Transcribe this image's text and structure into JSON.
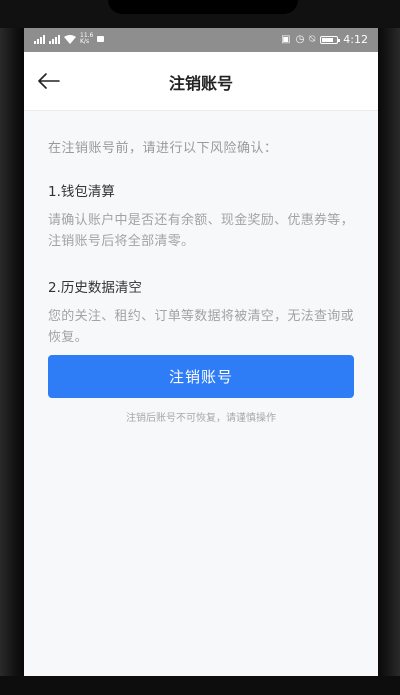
{
  "statusbar": {
    "net_speed_top": "11.6",
    "net_speed_bottom": "K/s",
    "time": "4:12"
  },
  "header": {
    "title": "注销账号",
    "back_icon": "arrow-left-icon"
  },
  "content": {
    "intro": "在注销账号前，请进行以下风险确认：",
    "sections": [
      {
        "title": "1.钱包清算",
        "body": "请确认账户中是否还有余额、现金奖励、优惠券等，注销账号后将全部清零。"
      },
      {
        "title": "2.历史数据清空",
        "body": "您的关注、租约、订单等数据将被清空，无法查询或恢复。"
      }
    ]
  },
  "action": {
    "button_label": "注销账号",
    "note": "注销后账号不可恢复，请谨慎操作"
  },
  "colors": {
    "accent": "#2f7df6",
    "background": "#f7f8fa",
    "statusbar": "#8e8e8e"
  }
}
